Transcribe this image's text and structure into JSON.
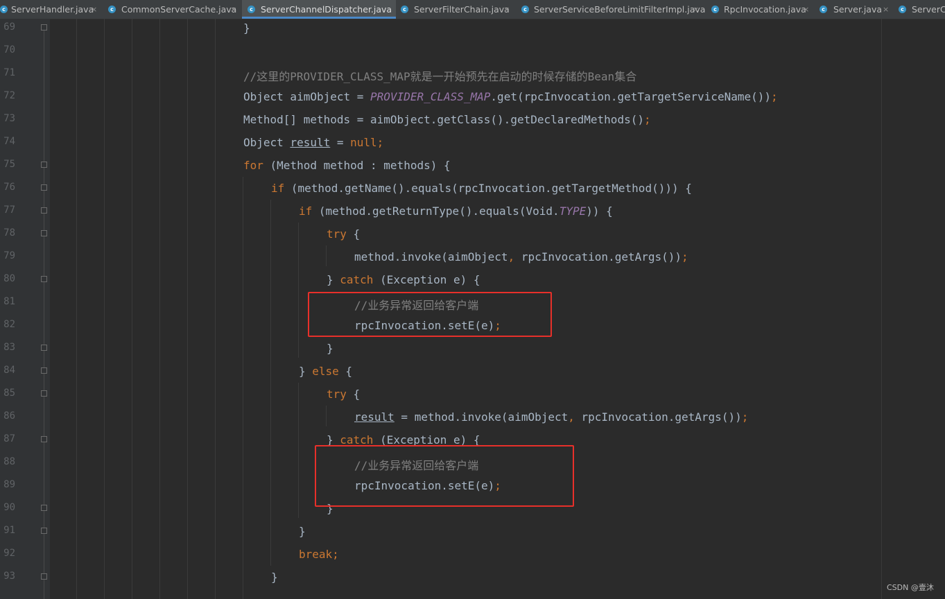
{
  "tabs": [
    {
      "name": "ServerHandler.java",
      "active": false
    },
    {
      "name": "CommonServerCache.java",
      "active": false
    },
    {
      "name": "ServerChannelDispatcher.java",
      "active": true
    },
    {
      "name": "ServerFilterChain.java",
      "active": false
    },
    {
      "name": "ServerServiceBeforeLimitFilterImpl.java",
      "active": false
    },
    {
      "name": "RpcInvocation.java",
      "active": false
    },
    {
      "name": "Server.java",
      "active": false
    },
    {
      "name": "ServerCo",
      "active": false
    }
  ],
  "close_glyph": "×",
  "class_icon_glyph": "c",
  "line_numbers": [
    "69",
    "70",
    "71",
    "72",
    "73",
    "74",
    "75",
    "76",
    "77",
    "78",
    "79",
    "80",
    "81",
    "82",
    "83",
    "84",
    "85",
    "86",
    "87",
    "88",
    "89",
    "90",
    "91",
    "92",
    "93"
  ],
  "code": {
    "l69": {
      "t1": "}"
    },
    "l71": {
      "t1": "//这里的PROVIDER_CLASS_MAP就是一开始预先在启动的时候存储的Bean集合"
    },
    "l72": {
      "t1": "Object aimObject = ",
      "t2": "PROVIDER_CLASS_MAP",
      "t3": ".get(rpcInvocation.getTargetServiceName())",
      "t4": ";"
    },
    "l73": {
      "t1": "Method[] methods = aimObject.getClass().getDeclaredMethods()",
      "t2": ";"
    },
    "l74": {
      "t1": "Object ",
      "t2": "result",
      "t3": " = ",
      "t4": "null;"
    },
    "l75": {
      "t1": "for",
      "t2": " (Method method : methods) {"
    },
    "l76": {
      "t1": "if",
      "t2": " (method.getName().equals(rpcInvocation.getTargetMethod())) {"
    },
    "l77": {
      "t1": "if",
      "t2": " (method.getReturnType().equals(Void.",
      "t3": "TYPE",
      "t4": ")) {"
    },
    "l78": {
      "t1": "try",
      "t2": " {"
    },
    "l79": {
      "t1": "method.invoke(aimObject",
      "t2": ",",
      "t3": " rpcInvocation.getArgs())",
      "t4": ";"
    },
    "l80": {
      "t1": "} ",
      "t2": "catch",
      "t3": " (Exception e) {"
    },
    "l81": {
      "t1": "//业务异常返回给客户端"
    },
    "l82": {
      "t1": "rpcInvocation.setE(e)",
      "t2": ";"
    },
    "l83": {
      "t1": "}"
    },
    "l84": {
      "t1": "} ",
      "t2": "else",
      "t3": " {"
    },
    "l85": {
      "t1": "try",
      "t2": " {"
    },
    "l86": {
      "t1": "result",
      "t2": " = method.invoke(aimObject",
      "t3": ",",
      "t4": " rpcInvocation.getArgs())",
      "t5": ";"
    },
    "l87": {
      "t1": "} ",
      "t2": "catch",
      "t3": " (Exception e) {"
    },
    "l88": {
      "t1": "//业务异常返回给客户端"
    },
    "l89": {
      "t1": "rpcInvocation.setE(e)",
      "t2": ";"
    },
    "l90": {
      "t1": "}"
    },
    "l91": {
      "t1": "}"
    },
    "l92": {
      "t1": "break;"
    },
    "l93": {
      "t1": "}"
    }
  },
  "watermark": "CSDN @壹沐",
  "colors": {
    "background": "#2b2b2b",
    "keyword": "#cc7832",
    "comment": "#808080",
    "static_field": "#9876aa",
    "text": "#a9b7c6",
    "highlight_box": "#e8302a",
    "active_tab_underline": "#4a88c7"
  }
}
